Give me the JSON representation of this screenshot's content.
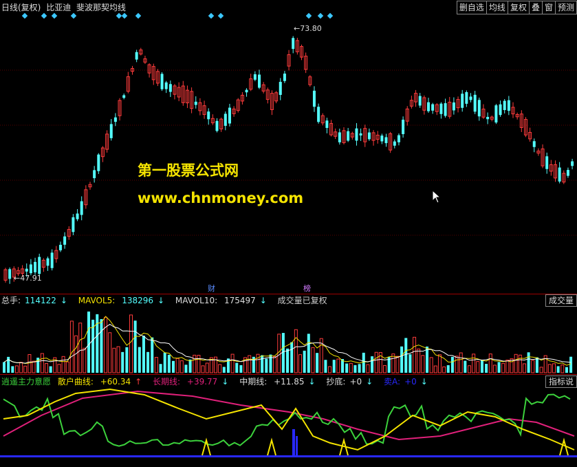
{
  "header": {
    "period": "日线(复权)",
    "stock": "比亚迪",
    "indicator": "斐波那契均线",
    "buttons": [
      "删自选",
      "均线",
      "复权",
      "叠",
      "窗",
      "预测"
    ]
  },
  "price_chart": {
    "high_label": "73.80",
    "low_label": "47.91",
    "marker_cai": "财",
    "marker_bang": "榜"
  },
  "watermark": {
    "line1": "第一股票公式网",
    "line2": "www.chnmoney.com"
  },
  "volume_panel": {
    "label_total": "总手:",
    "total": "114122",
    "label_mavol5": "MAVOL5:",
    "mavol5": "138296",
    "label_mavol10": "MAVOL10:",
    "mavol10": "175497",
    "note": "成交量已复权",
    "right_tag": "成交量"
  },
  "indicator_panel": {
    "name": "逍遥主力意愿",
    "label_retail": "散户曲线:",
    "retail": "+60.34",
    "label_long": "长期线:",
    "long": "+39.77",
    "label_mid": "中期线:",
    "mid": "+11.85",
    "label_bottom": "抄底:",
    "bottom": "+0",
    "label_sell": "卖A:",
    "sell": "+0",
    "right_tag": "指标说"
  },
  "colors": {
    "up": "#ff3c3c",
    "down": "#54ffff",
    "accent_yellow": "#f5e400",
    "green_line": "#3cd23c",
    "magenta_line": "#e0207a",
    "blue_base": "#2828ff",
    "diamond": "#3cc8ff"
  },
  "arrow_up": "↑",
  "arrow_down": "↓",
  "arrow_left": "←"
}
